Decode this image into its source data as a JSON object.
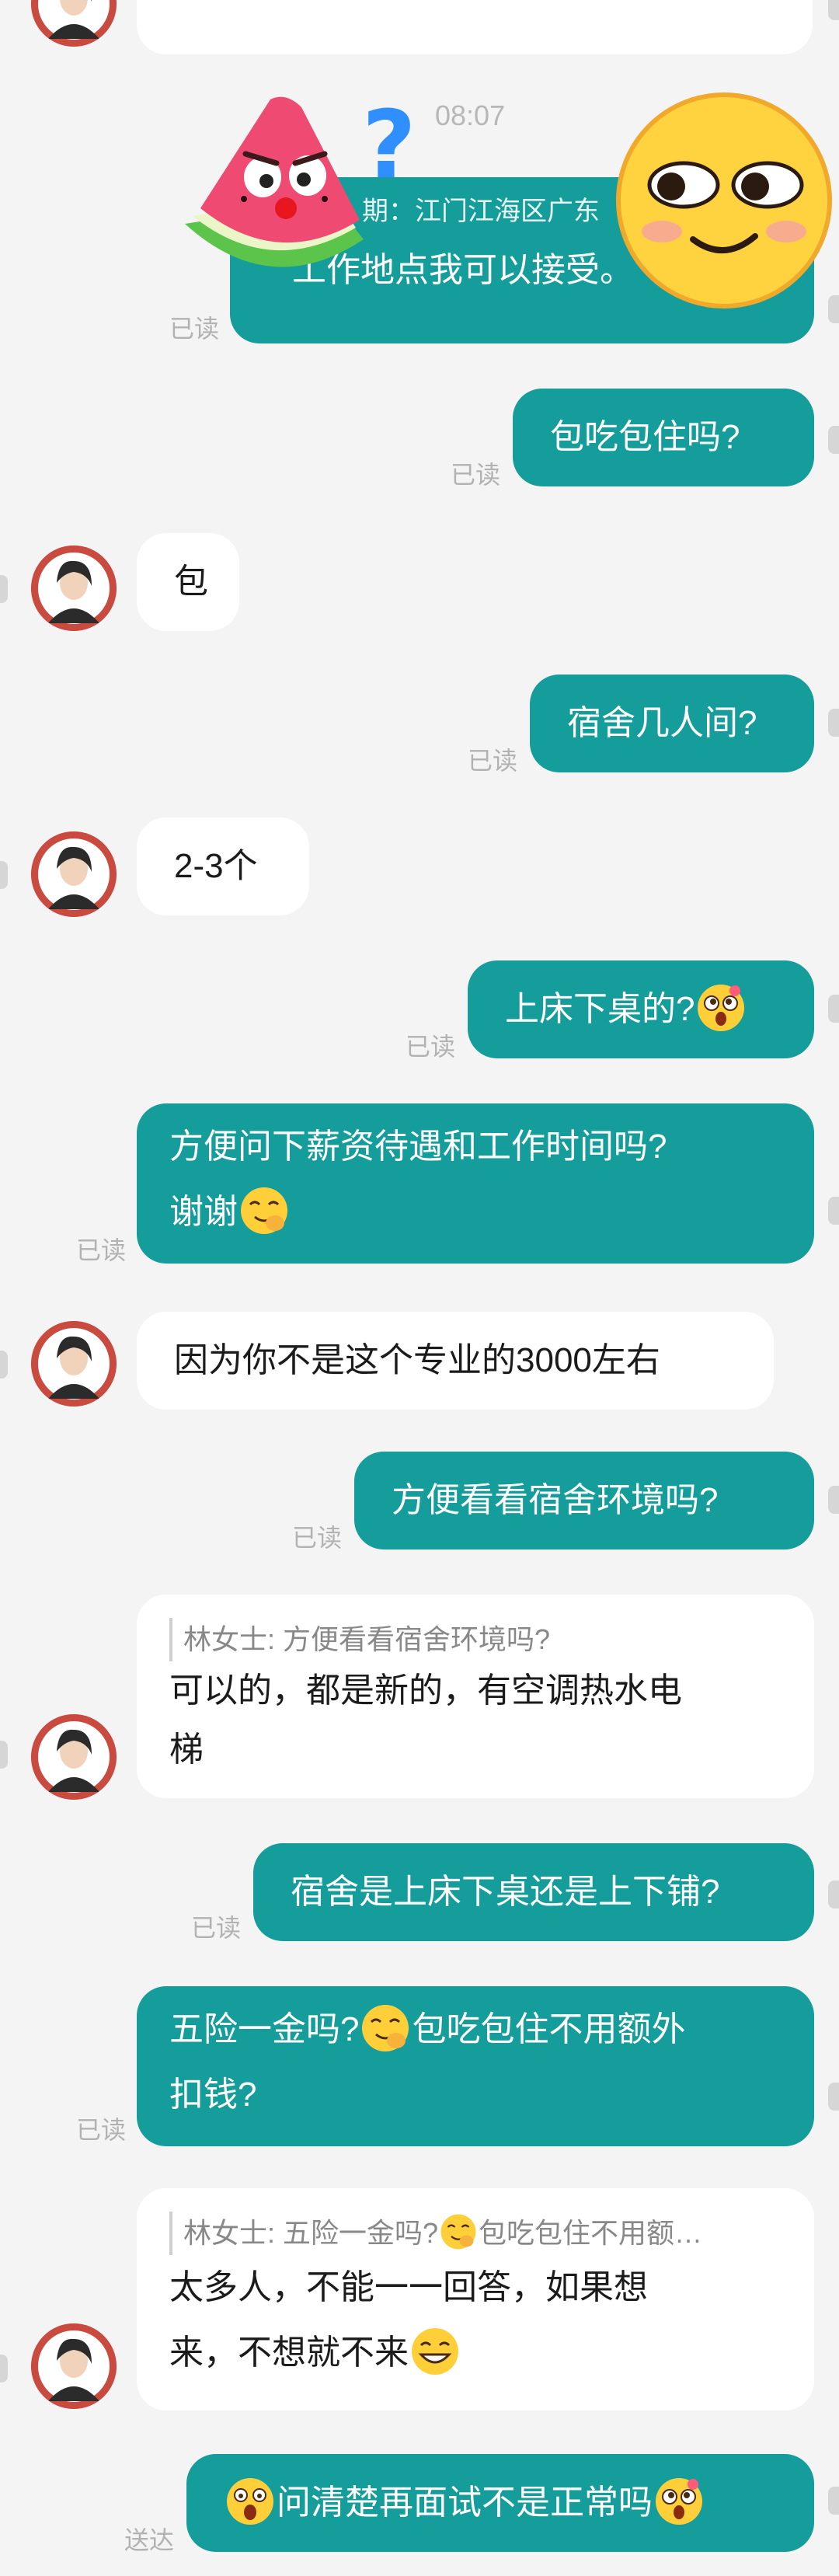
{
  "chat": {
    "timestamp": "08:07",
    "messages": [
      {
        "quote": "期：江门江海区广东",
        "text": "工作地点我可以接受。",
        "status": "已读"
      },
      {
        "text": "包吃包住吗?",
        "status": "已读"
      },
      {
        "text": "包"
      },
      {
        "text": "宿舍几人间?",
        "status": "已读"
      },
      {
        "text": "2-3个"
      },
      {
        "text": "上床下桌的?",
        "status": "已读"
      },
      {
        "line1": "方便问下薪资待遇和工作时间吗?",
        "line2": "谢谢",
        "status": "已读"
      },
      {
        "text": "因为你不是这个专业的3000左右"
      },
      {
        "text": "方便看看宿舍环境吗?",
        "status": "已读"
      },
      {
        "quote": "林女士: 方便看看宿舍环境吗?",
        "line1": "可以的，都是新的，有空调热水电",
        "line2": "梯"
      },
      {
        "text": "宿舍是上床下桌还是上下铺?",
        "status": "已读"
      },
      {
        "line1a": "五险一金吗?",
        "line1b": "包吃包住不用额外",
        "line2": "扣钱?",
        "status": "已读"
      },
      {
        "quote_a": "林女士: 五险一金吗?",
        "quote_b": "包吃包住不用额…",
        "line1": "太多人，不能一一回答，如果想",
        "line2": "来，不想就不来"
      },
      {
        "text": "问清楚再面试不是正常吗",
        "status": "送达"
      }
    ]
  },
  "stickers": {
    "left": "watermelon-question-sticker",
    "right": "smirk-emoji-sticker"
  },
  "colors": {
    "outgoing": "#149d9a",
    "incoming": "#ffffff",
    "background": "#f4f4f4"
  }
}
